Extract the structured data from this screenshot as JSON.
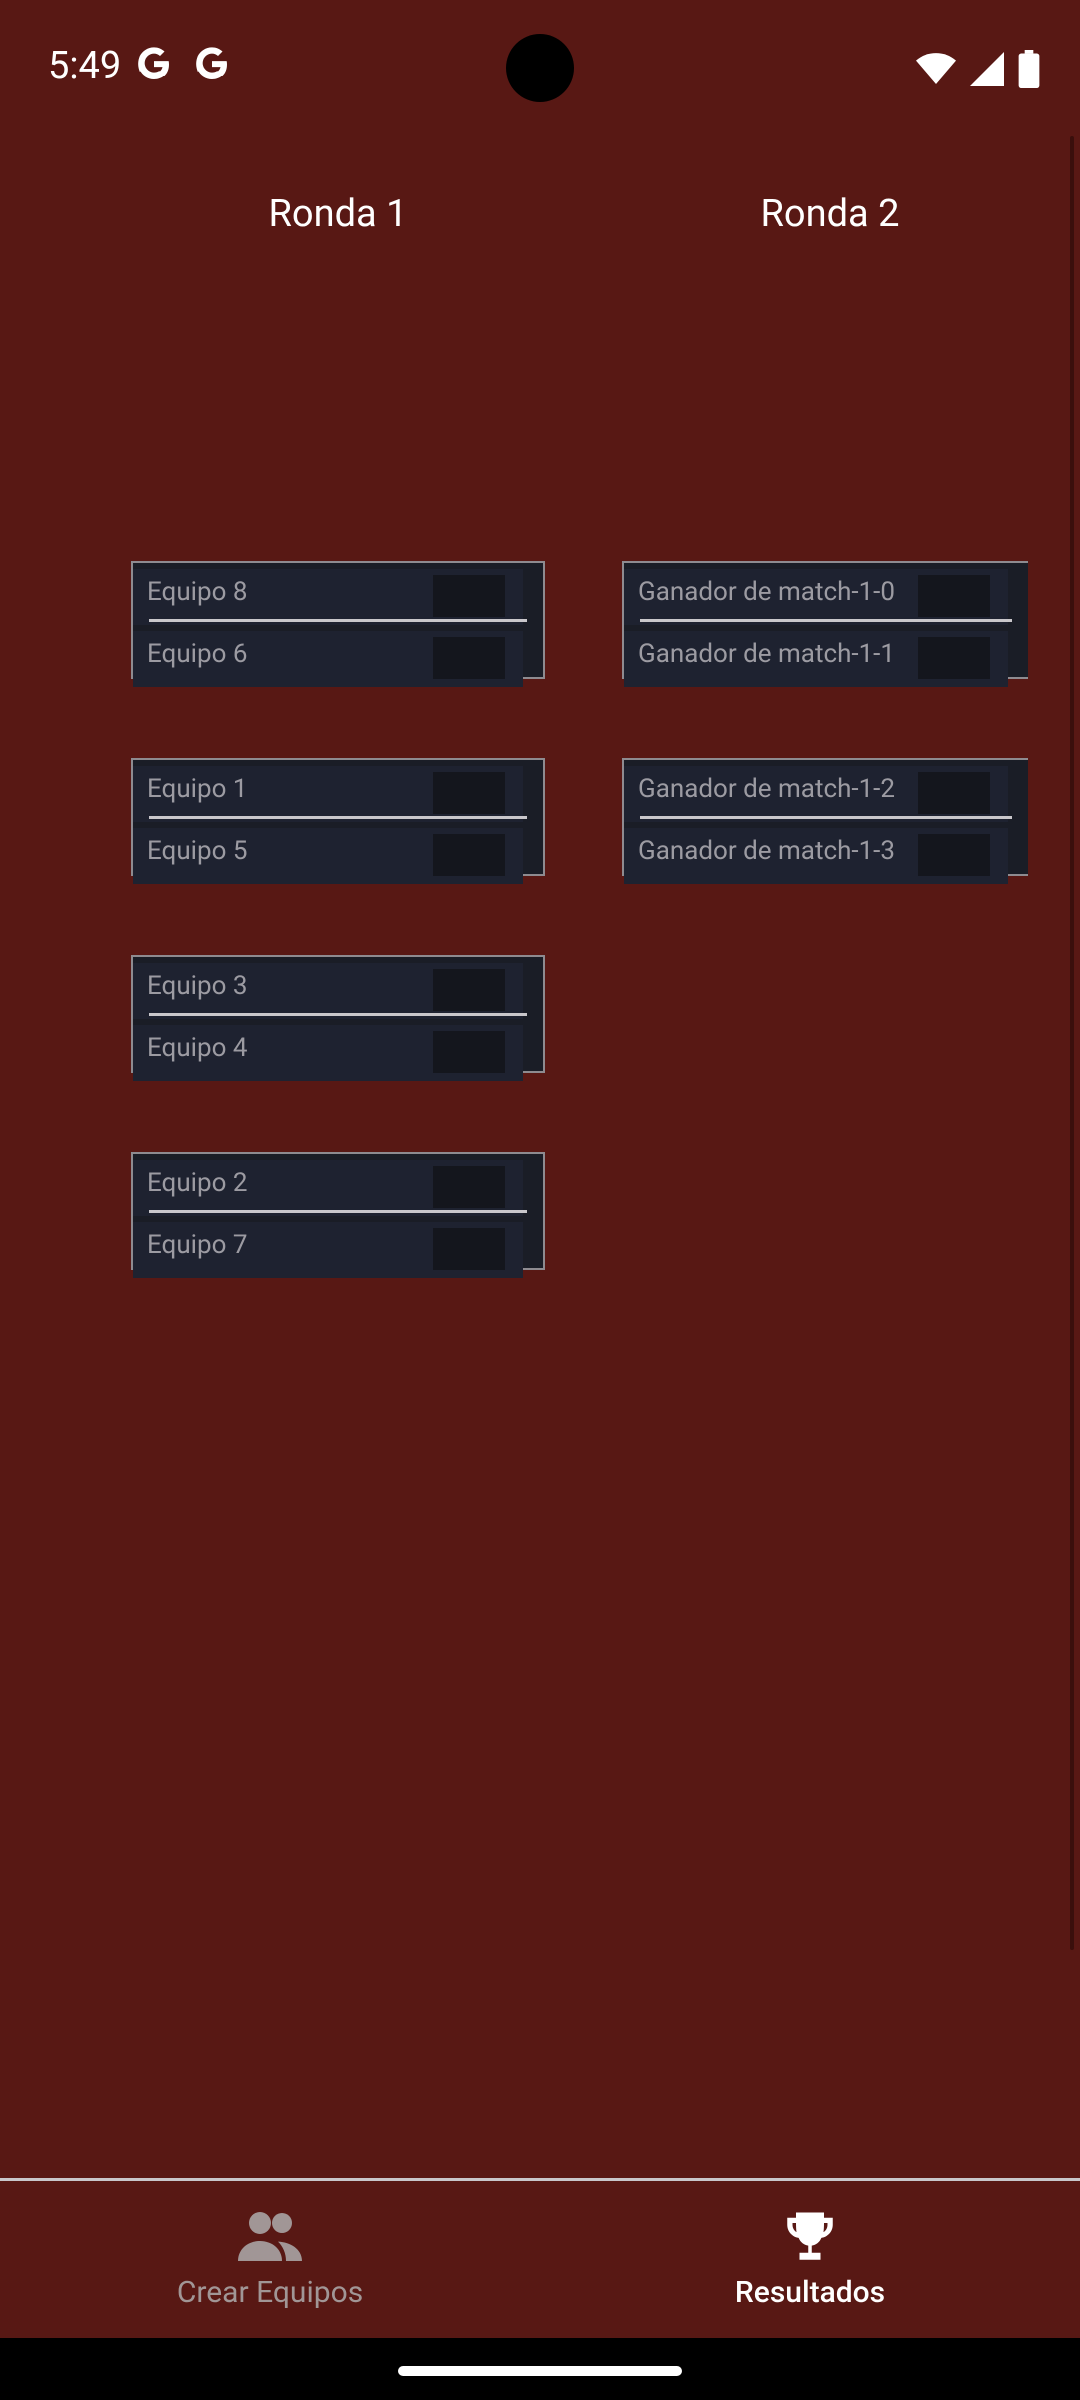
{
  "status": {
    "time": "5:49"
  },
  "rounds": [
    {
      "title": "Ronda 1",
      "matches": [
        {
          "team_a": "Equipo 8",
          "team_b": "Equipo 6"
        },
        {
          "team_a": "Equipo 1",
          "team_b": "Equipo 5"
        },
        {
          "team_a": "Equipo 3",
          "team_b": "Equipo 4"
        },
        {
          "team_a": "Equipo 2",
          "team_b": "Equipo 7"
        }
      ]
    },
    {
      "title": "Ronda 2",
      "matches": [
        {
          "team_a": "Ganador de match-1-0",
          "team_b": "Ganador de match-1-1"
        },
        {
          "team_a": "Ganador de match-1-2",
          "team_b": "Ganador de match-1-3"
        }
      ]
    }
  ],
  "nav": {
    "crear_label": "Crear Equipos",
    "resultados_label": "Resultados",
    "active": "resultados"
  },
  "colors": {
    "background": "#581814",
    "card": "#1a1d26",
    "inactive_nav": "#a19696"
  }
}
